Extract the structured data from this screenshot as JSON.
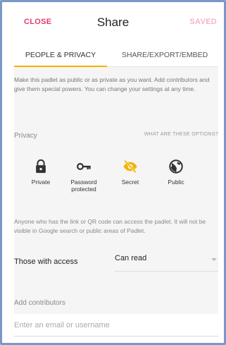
{
  "header": {
    "close_label": "CLOSE",
    "title": "Share",
    "status_label": "SAVED"
  },
  "tabs": [
    {
      "label": "PEOPLE & PRIVACY",
      "active": true
    },
    {
      "label": "SHARE/EXPORT/EMBED",
      "active": false
    }
  ],
  "intro_text": "Make this padlet as public or as private as you want. Add contributors and give them special powers. You can change your settings at any time.",
  "privacy": {
    "section_label": "Privacy",
    "help_link": "WHAT ARE THESE OPTIONS?",
    "options": [
      {
        "label": "Private",
        "icon": "lock-icon",
        "selected": false
      },
      {
        "label": "Password protected",
        "icon": "key-icon",
        "selected": false
      },
      {
        "label": "Secret",
        "icon": "eye-slash-icon",
        "selected": true
      },
      {
        "label": "Public",
        "icon": "globe-icon",
        "selected": false
      }
    ],
    "selected_color": "#f4b400",
    "description": "Anyone who has the link or QR code can access the padlet. It will not be visible in Google search or public areas of Padlet."
  },
  "access": {
    "label": "Those with access",
    "value": "Can read"
  },
  "contributors": {
    "section_label": "Add contributors",
    "placeholder": "Enter an email or username",
    "value": ""
  },
  "colors": {
    "accent_pink": "#e23c6b",
    "accent_yellow": "#f4b400"
  }
}
